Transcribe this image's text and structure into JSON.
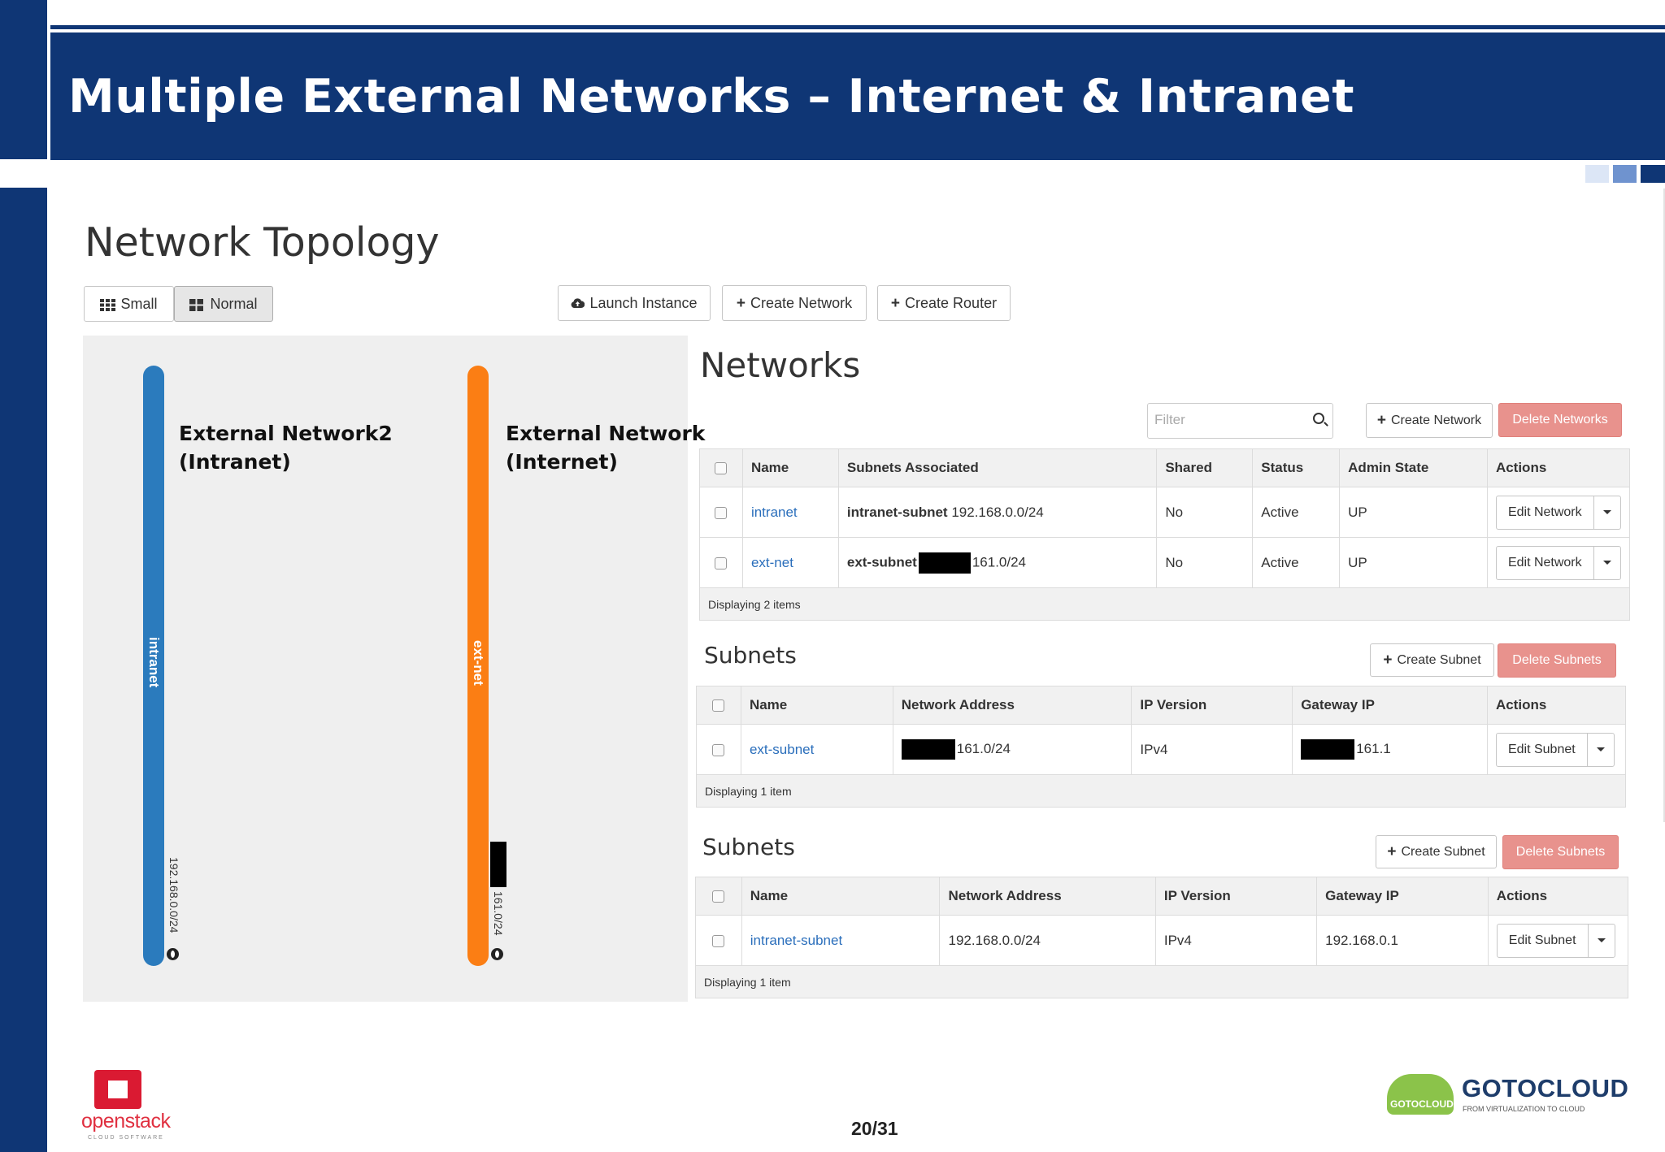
{
  "slide": {
    "title": "Multiple External Networks – Internet & Intranet",
    "page_number": "20/31",
    "colors": {
      "header_band": "#0f3675",
      "intranet_bar": "#2b7bbd",
      "extnet_bar": "#fb7e14",
      "danger_button": "#e8928d",
      "link": "#2a6ebb"
    }
  },
  "topology": {
    "heading": "Network Topology",
    "view_buttons": {
      "small": "Small",
      "normal": "Normal"
    },
    "actions": {
      "launch_instance": "Launch Instance",
      "create_network": "Create Network",
      "create_router": "Create Router"
    },
    "networks": [
      {
        "bar_label": "intranet",
        "cidr": "192.168.0.0/24",
        "caption_line1": "External Network2",
        "caption_line2": "(Intranet)"
      },
      {
        "bar_label": "ext-net",
        "cidr": "161.0/24",
        "caption_line1": "External Network",
        "caption_line2": "(Internet)"
      }
    ]
  },
  "networks_panel": {
    "heading": "Networks",
    "filter_placeholder": "Filter",
    "create_button": "Create Network",
    "delete_button": "Delete Networks",
    "columns": [
      "Name",
      "Subnets Associated",
      "Shared",
      "Status",
      "Admin State",
      "Actions"
    ],
    "rows": [
      {
        "name": "intranet",
        "subnet_name": "intranet-subnet",
        "subnet_cidr": "192.168.0.0/24",
        "shared": "No",
        "status": "Active",
        "admin_state": "UP",
        "action": "Edit Network"
      },
      {
        "name": "ext-net",
        "subnet_name": "ext-subnet",
        "subnet_cidr": "161.0/24",
        "shared": "No",
        "status": "Active",
        "admin_state": "UP",
        "action": "Edit Network"
      }
    ],
    "footer": "Displaying 2 items"
  },
  "subnets_panel_1": {
    "heading": "Subnets",
    "create_button": "Create Subnet",
    "delete_button": "Delete Subnets",
    "columns": [
      "Name",
      "Network Address",
      "IP Version",
      "Gateway IP",
      "Actions"
    ],
    "rows": [
      {
        "name": "ext-subnet",
        "network_address": "161.0/24",
        "ip_version": "IPv4",
        "gateway_ip": "161.1",
        "action": "Edit Subnet"
      }
    ],
    "footer": "Displaying 1 item"
  },
  "subnets_panel_2": {
    "heading": "Subnets",
    "create_button": "Create Subnet",
    "delete_button": "Delete Subnets",
    "columns": [
      "Name",
      "Network Address",
      "IP Version",
      "Gateway IP",
      "Actions"
    ],
    "rows": [
      {
        "name": "intranet-subnet",
        "network_address": "192.168.0.0/24",
        "ip_version": "IPv4",
        "gateway_ip": "192.168.0.1",
        "action": "Edit Subnet"
      }
    ],
    "footer": "Displaying 1 item"
  },
  "logos": {
    "openstack_word": "openstack",
    "openstack_sub": "CLOUD SOFTWARE",
    "gotocloud_word": "GOTOCLOUD",
    "gotocloud_tagline": "FROM VIRTUALIZATION TO CLOUD",
    "gotocloud_cloud_text": "GOTOCLOUD"
  }
}
